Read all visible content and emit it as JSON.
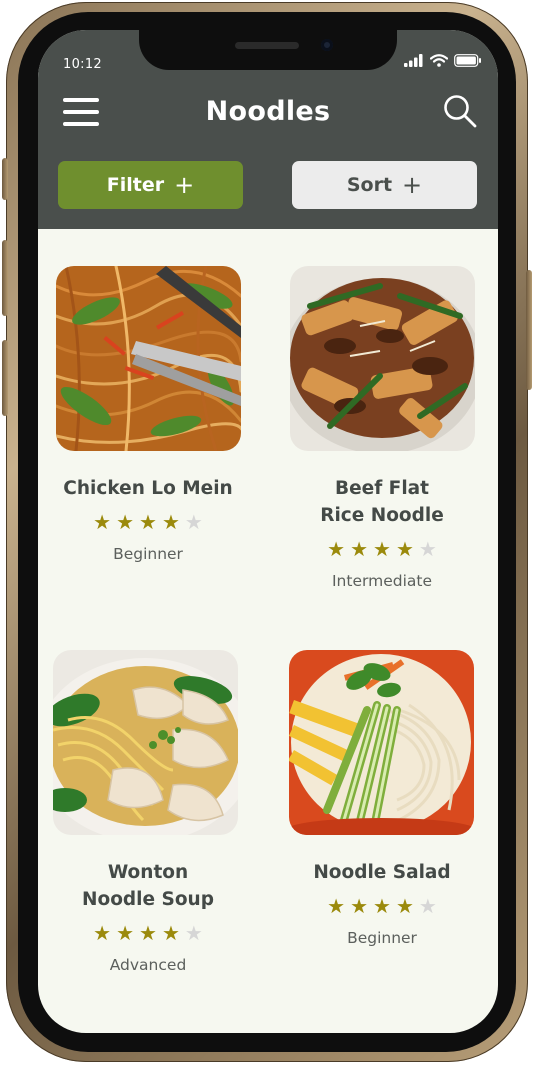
{
  "status_bar": {
    "time": "10:12",
    "icons": [
      "signal-icon",
      "wifi-icon",
      "battery-icon"
    ]
  },
  "header": {
    "title": "Noodles",
    "menu_icon": "hamburger-menu-icon",
    "search_icon": "search-icon",
    "background": "#4a4f4c"
  },
  "toolbar": {
    "filter_label": "Filter",
    "sort_label": "Sort",
    "filter_color": "#6f8f2e",
    "sort_color": "#ececec"
  },
  "colors": {
    "page_background": "#f6f8f0",
    "star_on": "#9b8a0c",
    "star_off": "#d6d6d6"
  },
  "recipes": [
    {
      "name_lines": [
        "Chicken Lo Mein"
      ],
      "rating": 4,
      "max_rating": 5,
      "level": "Beginner"
    },
    {
      "name_lines": [
        "Beef Flat",
        "Rice Noodle"
      ],
      "rating": 4,
      "max_rating": 5,
      "level": "Intermediate"
    },
    {
      "name_lines": [
        "Wonton",
        "Noodle Soup"
      ],
      "rating": 4,
      "max_rating": 5,
      "level": "Advanced"
    },
    {
      "name_lines": [
        "Noodle Salad"
      ],
      "rating": 4,
      "max_rating": 5,
      "level": "Beginner"
    }
  ]
}
